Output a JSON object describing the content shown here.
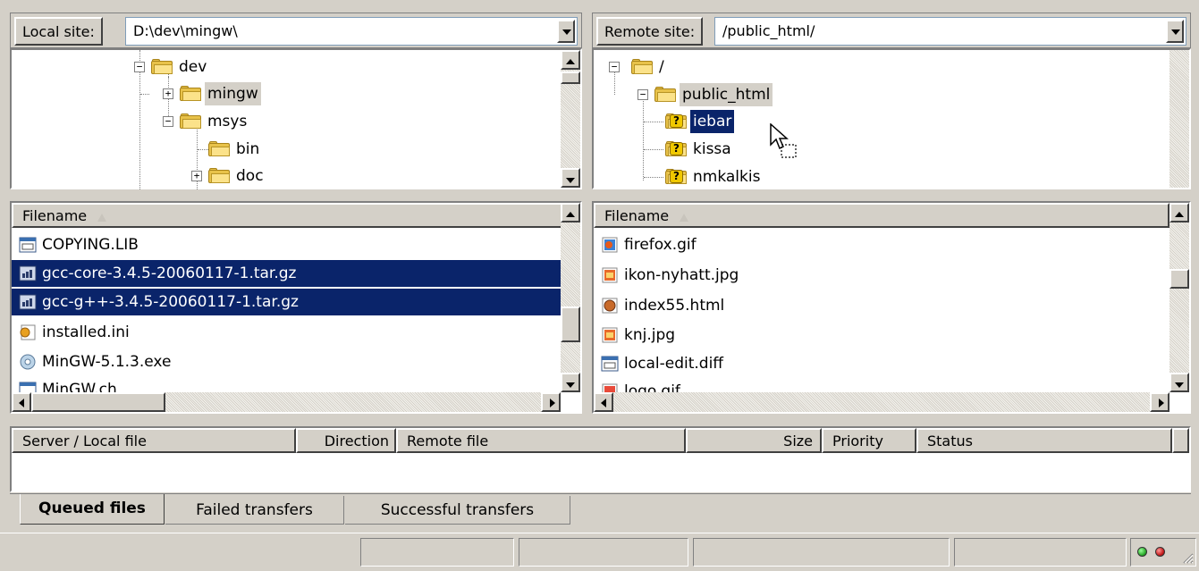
{
  "local_site": {
    "label": "Local site:",
    "path": "D:\\dev\\mingw\\",
    "tree": [
      {
        "name": "dev",
        "expander": "−"
      },
      {
        "name": "mingw",
        "expander": "+"
      },
      {
        "name": "msys",
        "expander": "−"
      },
      {
        "name": "bin",
        "expander": ""
      },
      {
        "name": "doc",
        "expander": "+"
      }
    ]
  },
  "remote_site": {
    "label": "Remote site:",
    "path": "/public_html/",
    "tree": [
      {
        "name": "/",
        "expander": "−"
      },
      {
        "name": "public_html",
        "expander": "−"
      },
      {
        "name": "iebar",
        "expander": ""
      },
      {
        "name": "kissa",
        "expander": ""
      },
      {
        "name": "nmkalkis",
        "expander": ""
      }
    ]
  },
  "local_files": {
    "header": "Filename",
    "files": [
      {
        "name": "COPYING.LIB",
        "icon": "text-file-icon"
      },
      {
        "name": "gcc-core-3.4.5-20060117-1.tar.gz",
        "icon": "archive-icon",
        "selected": true
      },
      {
        "name": "gcc-g++-3.4.5-20060117-1.tar.gz",
        "icon": "archive-icon",
        "selected": true
      },
      {
        "name": "installed.ini",
        "icon": "ini-file-icon"
      },
      {
        "name": "MinGW-5.1.3.exe",
        "icon": "installer-icon"
      },
      {
        "name": "MinGW.ch",
        "icon": "text-file-icon"
      }
    ]
  },
  "remote_files": {
    "header": "Filename",
    "files": [
      {
        "name": "firefox.gif",
        "icon": "image-icon"
      },
      {
        "name": "ikon-nyhatt.jpg",
        "icon": "image-icon"
      },
      {
        "name": "index55.html",
        "icon": "html-icon"
      },
      {
        "name": "knj.jpg",
        "icon": "image-icon"
      },
      {
        "name": "local-edit.diff",
        "icon": "text-file-icon"
      },
      {
        "name": "logo.gif",
        "icon": "image-icon"
      }
    ]
  },
  "queue": {
    "columns": [
      "Server / Local file",
      "Direction",
      "Remote file",
      "Size",
      "Priority",
      "Status"
    ]
  },
  "tabs": [
    "Queued files",
    "Failed transfers",
    "Successful transfers"
  ],
  "colors": {
    "selection": "#0a246a",
    "window_bg": "#d4d0c8",
    "led_green": "#2fae2f",
    "led_red": "#c81e1e"
  }
}
